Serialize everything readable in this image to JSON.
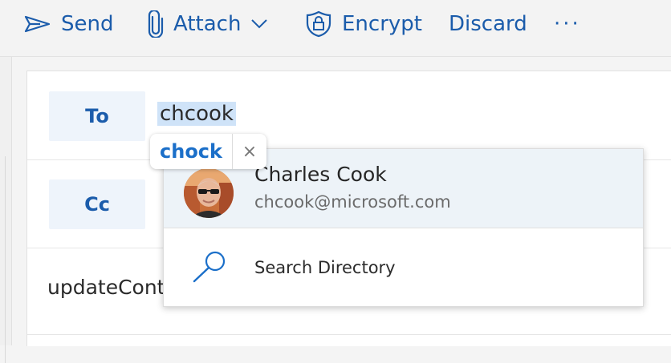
{
  "toolbar": {
    "send_label": "Send",
    "attach_label": "Attach",
    "encrypt_label": "Encrypt",
    "discard_label": "Discard",
    "more_label": "···"
  },
  "compose": {
    "to_label": "To",
    "to_value": "chcook",
    "cc_label": "Cc",
    "subject_value": "updateCont"
  },
  "chip": {
    "text": "chock",
    "remove": "×"
  },
  "suggestions": {
    "contact": {
      "name": "Charles Cook",
      "email": "chcook@microsoft.com"
    },
    "search_directory": "Search Directory"
  },
  "colors": {
    "accent": "#1b5cab",
    "chip_text": "#1b6fc9",
    "selection": "#cfe3f8",
    "suggestion_highlight": "#edf3f8"
  }
}
